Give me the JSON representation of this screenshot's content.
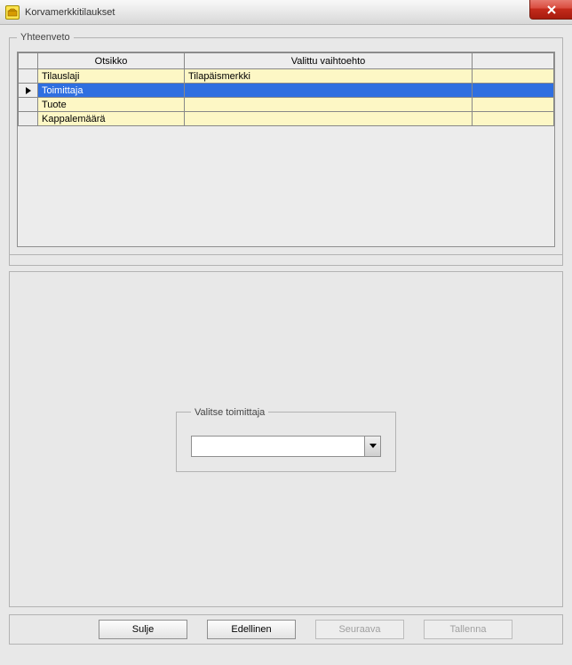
{
  "window": {
    "title": "Korvamerkkitilaukset"
  },
  "summary": {
    "legend": "Yhteenveto",
    "columns": {
      "c1": "Otsikko",
      "c2": "Valittu vaihtoehto",
      "c3": ""
    },
    "rows": [
      {
        "label": "Tilauslaji",
        "value": "Tilapäismerkki",
        "extra": "",
        "selected": false
      },
      {
        "label": "Toimittaja",
        "value": "",
        "extra": "",
        "selected": true
      },
      {
        "label": "Tuote",
        "value": "",
        "extra": "",
        "selected": false
      },
      {
        "label": "Kappalemäärä",
        "value": "",
        "extra": "",
        "selected": false
      }
    ]
  },
  "selector": {
    "legend": "Valitse toimittaja",
    "combo_value": ""
  },
  "buttons": {
    "close": "Sulje",
    "previous": "Edellinen",
    "next": "Seuraava",
    "save": "Tallenna"
  }
}
